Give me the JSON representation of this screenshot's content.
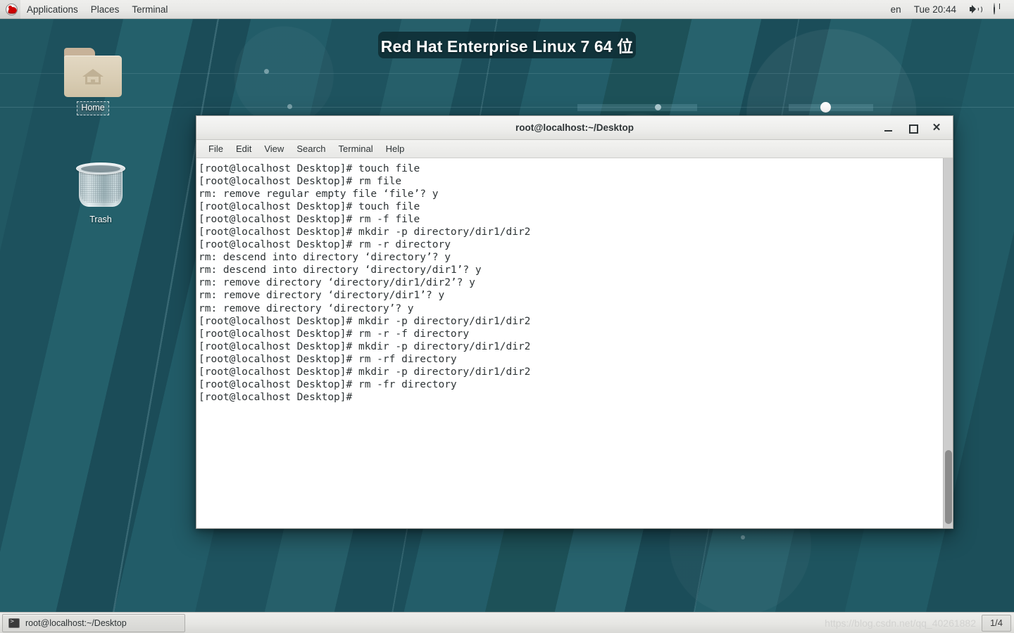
{
  "top_panel": {
    "logo_icon": "redhat-logo-icon",
    "menus": [
      "Applications",
      "Places",
      "Terminal"
    ],
    "keyboard_layout": "en",
    "clock": "Tue 20:44",
    "volume_icon": "speaker-volume-icon",
    "power_icon": "power-icon"
  },
  "desktop": {
    "banner_title": "Red Hat Enterprise Linux 7 64 位",
    "icons": [
      {
        "label": "Home",
        "icon": "home-folder-icon",
        "selected": true
      },
      {
        "label": "Trash",
        "icon": "trash-can-icon",
        "selected": false
      }
    ]
  },
  "terminal": {
    "title": "root@localhost:~/Desktop",
    "menu": [
      "File",
      "Edit",
      "View",
      "Search",
      "Terminal",
      "Help"
    ],
    "window_buttons": {
      "minimize": "minimize-icon",
      "maximize": "maximize-icon",
      "close": "✕"
    },
    "lines": [
      "[root@localhost Desktop]# touch file",
      "[root@localhost Desktop]# rm file",
      "rm: remove regular empty file ‘file’? y",
      "[root@localhost Desktop]# touch file",
      "[root@localhost Desktop]# rm -f file",
      "[root@localhost Desktop]# mkdir -p directory/dir1/dir2",
      "[root@localhost Desktop]# rm -r directory",
      "rm: descend into directory ‘directory’? y",
      "rm: descend into directory ‘directory/dir1’? y",
      "rm: remove directory ‘directory/dir1/dir2’? y",
      "rm: remove directory ‘directory/dir1’? y",
      "rm: remove directory ‘directory’? y",
      "[root@localhost Desktop]# mkdir -p directory/dir1/dir2",
      "[root@localhost Desktop]# rm -r -f directory",
      "[root@localhost Desktop]# mkdir -p directory/dir1/dir2",
      "[root@localhost Desktop]# rm -rf directory",
      "[root@localhost Desktop]# mkdir -p directory/dir1/dir2",
      "[root@localhost Desktop]# rm -fr directory",
      "[root@localhost Desktop]# "
    ]
  },
  "bottom_panel": {
    "task_label": "root@localhost:~/Desktop",
    "task_icon": "terminal-window-icon",
    "watermark": "https://blog.csdn.net/qq_40261882",
    "workspace": "1/4"
  },
  "colors": {
    "desktop_teal": "#1f5763",
    "panel_grey": "#e9e9e7",
    "terminal_bg": "#ffffff",
    "terminal_fg": "#2e3436",
    "banner_bg": "#0f2d34"
  }
}
